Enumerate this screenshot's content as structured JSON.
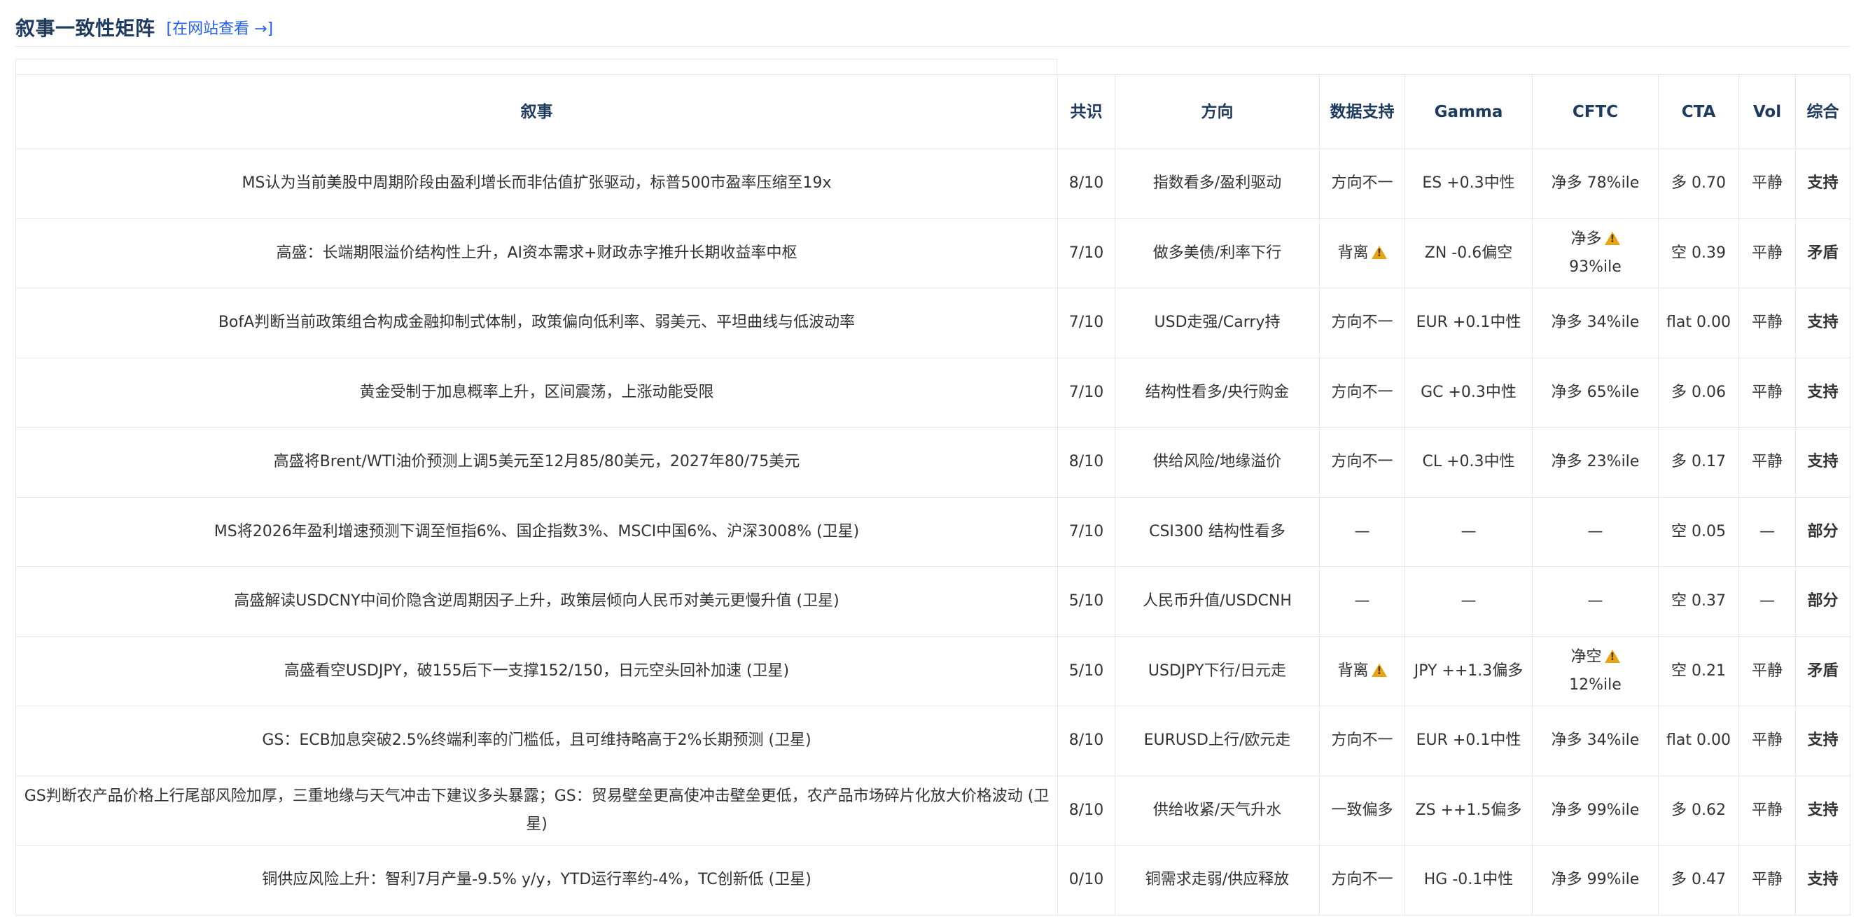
{
  "header": {
    "title": "叙事一致性矩阵",
    "site_link": "[在网站查看 →]"
  },
  "table": {
    "columns": [
      "叙事",
      "共识",
      "方向",
      "数据支持",
      "Gamma",
      "CFTC",
      "CTA",
      "Vol",
      "综合"
    ],
    "rows": [
      {
        "narrative": "MS认为当前美股中周期阶段由盈利增长而非估值扩张驱动，标普500市盈率压缩至19x",
        "consensus": "8/10",
        "direction": "指数看多/盈利驱动",
        "data_support": "方向不一",
        "data_warn": false,
        "gamma": "ES +0.3中性",
        "cftc": "净多 78%ile",
        "cftc_warn": false,
        "cta": "多 0.70",
        "vol": "平静",
        "verdict": "支持"
      },
      {
        "narrative": "高盛：长端期限溢价结构性上升，AI资本需求+财政赤字推升长期收益率中枢",
        "consensus": "7/10",
        "direction": "做多美债/利率下行",
        "data_support": "背离",
        "data_warn": true,
        "gamma": "ZN -0.6偏空",
        "cftc": "净多 93%ile",
        "cftc_warn": true,
        "cta": "空 0.39",
        "vol": "平静",
        "verdict": "矛盾"
      },
      {
        "narrative": "BofA判断当前政策组合构成金融抑制式体制，政策偏向低利率、弱美元、平坦曲线与低波动率",
        "consensus": "7/10",
        "direction": "USD走强/Carry持",
        "data_support": "方向不一",
        "data_warn": false,
        "gamma": "EUR +0.1中性",
        "cftc": "净多 34%ile",
        "cftc_warn": false,
        "cta": "flat 0.00",
        "vol": "平静",
        "verdict": "支持"
      },
      {
        "narrative": "黄金受制于加息概率上升，区间震荡，上涨动能受限",
        "consensus": "7/10",
        "direction": "结构性看多/央行购金",
        "data_support": "方向不一",
        "data_warn": false,
        "gamma": "GC +0.3中性",
        "cftc": "净多 65%ile",
        "cftc_warn": false,
        "cta": "多 0.06",
        "vol": "平静",
        "verdict": "支持"
      },
      {
        "narrative": "高盛将Brent/WTI油价预测上调5美元至12月85/80美元，2027年80/75美元",
        "consensus": "8/10",
        "direction": "供给风险/地缘溢价",
        "data_support": "方向不一",
        "data_warn": false,
        "gamma": "CL +0.3中性",
        "cftc": "净多 23%ile",
        "cftc_warn": false,
        "cta": "多 0.17",
        "vol": "平静",
        "verdict": "支持"
      },
      {
        "narrative": "MS将2026年盈利增速预测下调至恒指6%、国企指数3%、MSCI中国6%、沪深3008% (卫星)",
        "consensus": "7/10",
        "direction": "CSI300 结构性看多",
        "data_support": "—",
        "data_warn": false,
        "gamma": "—",
        "cftc": "—",
        "cftc_warn": false,
        "cta": "空 0.05",
        "vol": "—",
        "verdict": "部分"
      },
      {
        "narrative": "高盛解读USDCNY中间价隐含逆周期因子上升，政策层倾向人民币对美元更慢升值 (卫星)",
        "consensus": "5/10",
        "direction": "人民币升值/USDCNH",
        "data_support": "—",
        "data_warn": false,
        "gamma": "—",
        "cftc": "—",
        "cftc_warn": false,
        "cta": "空 0.37",
        "vol": "—",
        "verdict": "部分"
      },
      {
        "narrative": "高盛看空USDJPY，破155后下一支撑152/150，日元空头回补加速 (卫星)",
        "consensus": "5/10",
        "direction": "USDJPY下行/日元走",
        "data_support": "背离",
        "data_warn": true,
        "gamma": "JPY ++1.3偏多",
        "cftc": "净空 12%ile",
        "cftc_warn": true,
        "cta": "空 0.21",
        "vol": "平静",
        "verdict": "矛盾"
      },
      {
        "narrative": "GS：ECB加息突破2.5%终端利率的门槛低，且可维持略高于2%长期预测 (卫星)",
        "consensus": "8/10",
        "direction": "EURUSD上行/欧元走",
        "data_support": "方向不一",
        "data_warn": false,
        "gamma": "EUR +0.1中性",
        "cftc": "净多 34%ile",
        "cftc_warn": false,
        "cta": "flat 0.00",
        "vol": "平静",
        "verdict": "支持"
      },
      {
        "narrative": "GS判断农产品价格上行尾部风险加厚，三重地缘与天气冲击下建议多头暴露；GS：贸易壁垒更高使冲击壁垒更低，农产品市场碎片化放大价格波动 (卫星)",
        "consensus": "8/10",
        "direction": "供给收紧/天气升水",
        "data_support": "一致偏多",
        "data_warn": false,
        "gamma": "ZS ++1.5偏多",
        "cftc": "净多 99%ile",
        "cftc_warn": false,
        "cta": "多 0.62",
        "vol": "平静",
        "verdict": "支持"
      },
      {
        "narrative": "铜供应风险上升：智利7月产量-9.5% y/y，YTD运行率约-4%，TC创新低 (卫星)",
        "consensus": "0/10",
        "direction": "铜需求走弱/供应释放",
        "data_support": "方向不一",
        "data_warn": false,
        "gamma": "HG -0.1中性",
        "cftc": "净多 99%ile",
        "cftc_warn": false,
        "cta": "多 0.47",
        "vol": "平静",
        "verdict": "支持"
      }
    ]
  },
  "colors": {
    "title": "#1e3a5f",
    "link": "#2563eb",
    "border": "#e5e7eb",
    "warning": "#e8a317"
  },
  "icons": {
    "warning": "warning-icon"
  }
}
